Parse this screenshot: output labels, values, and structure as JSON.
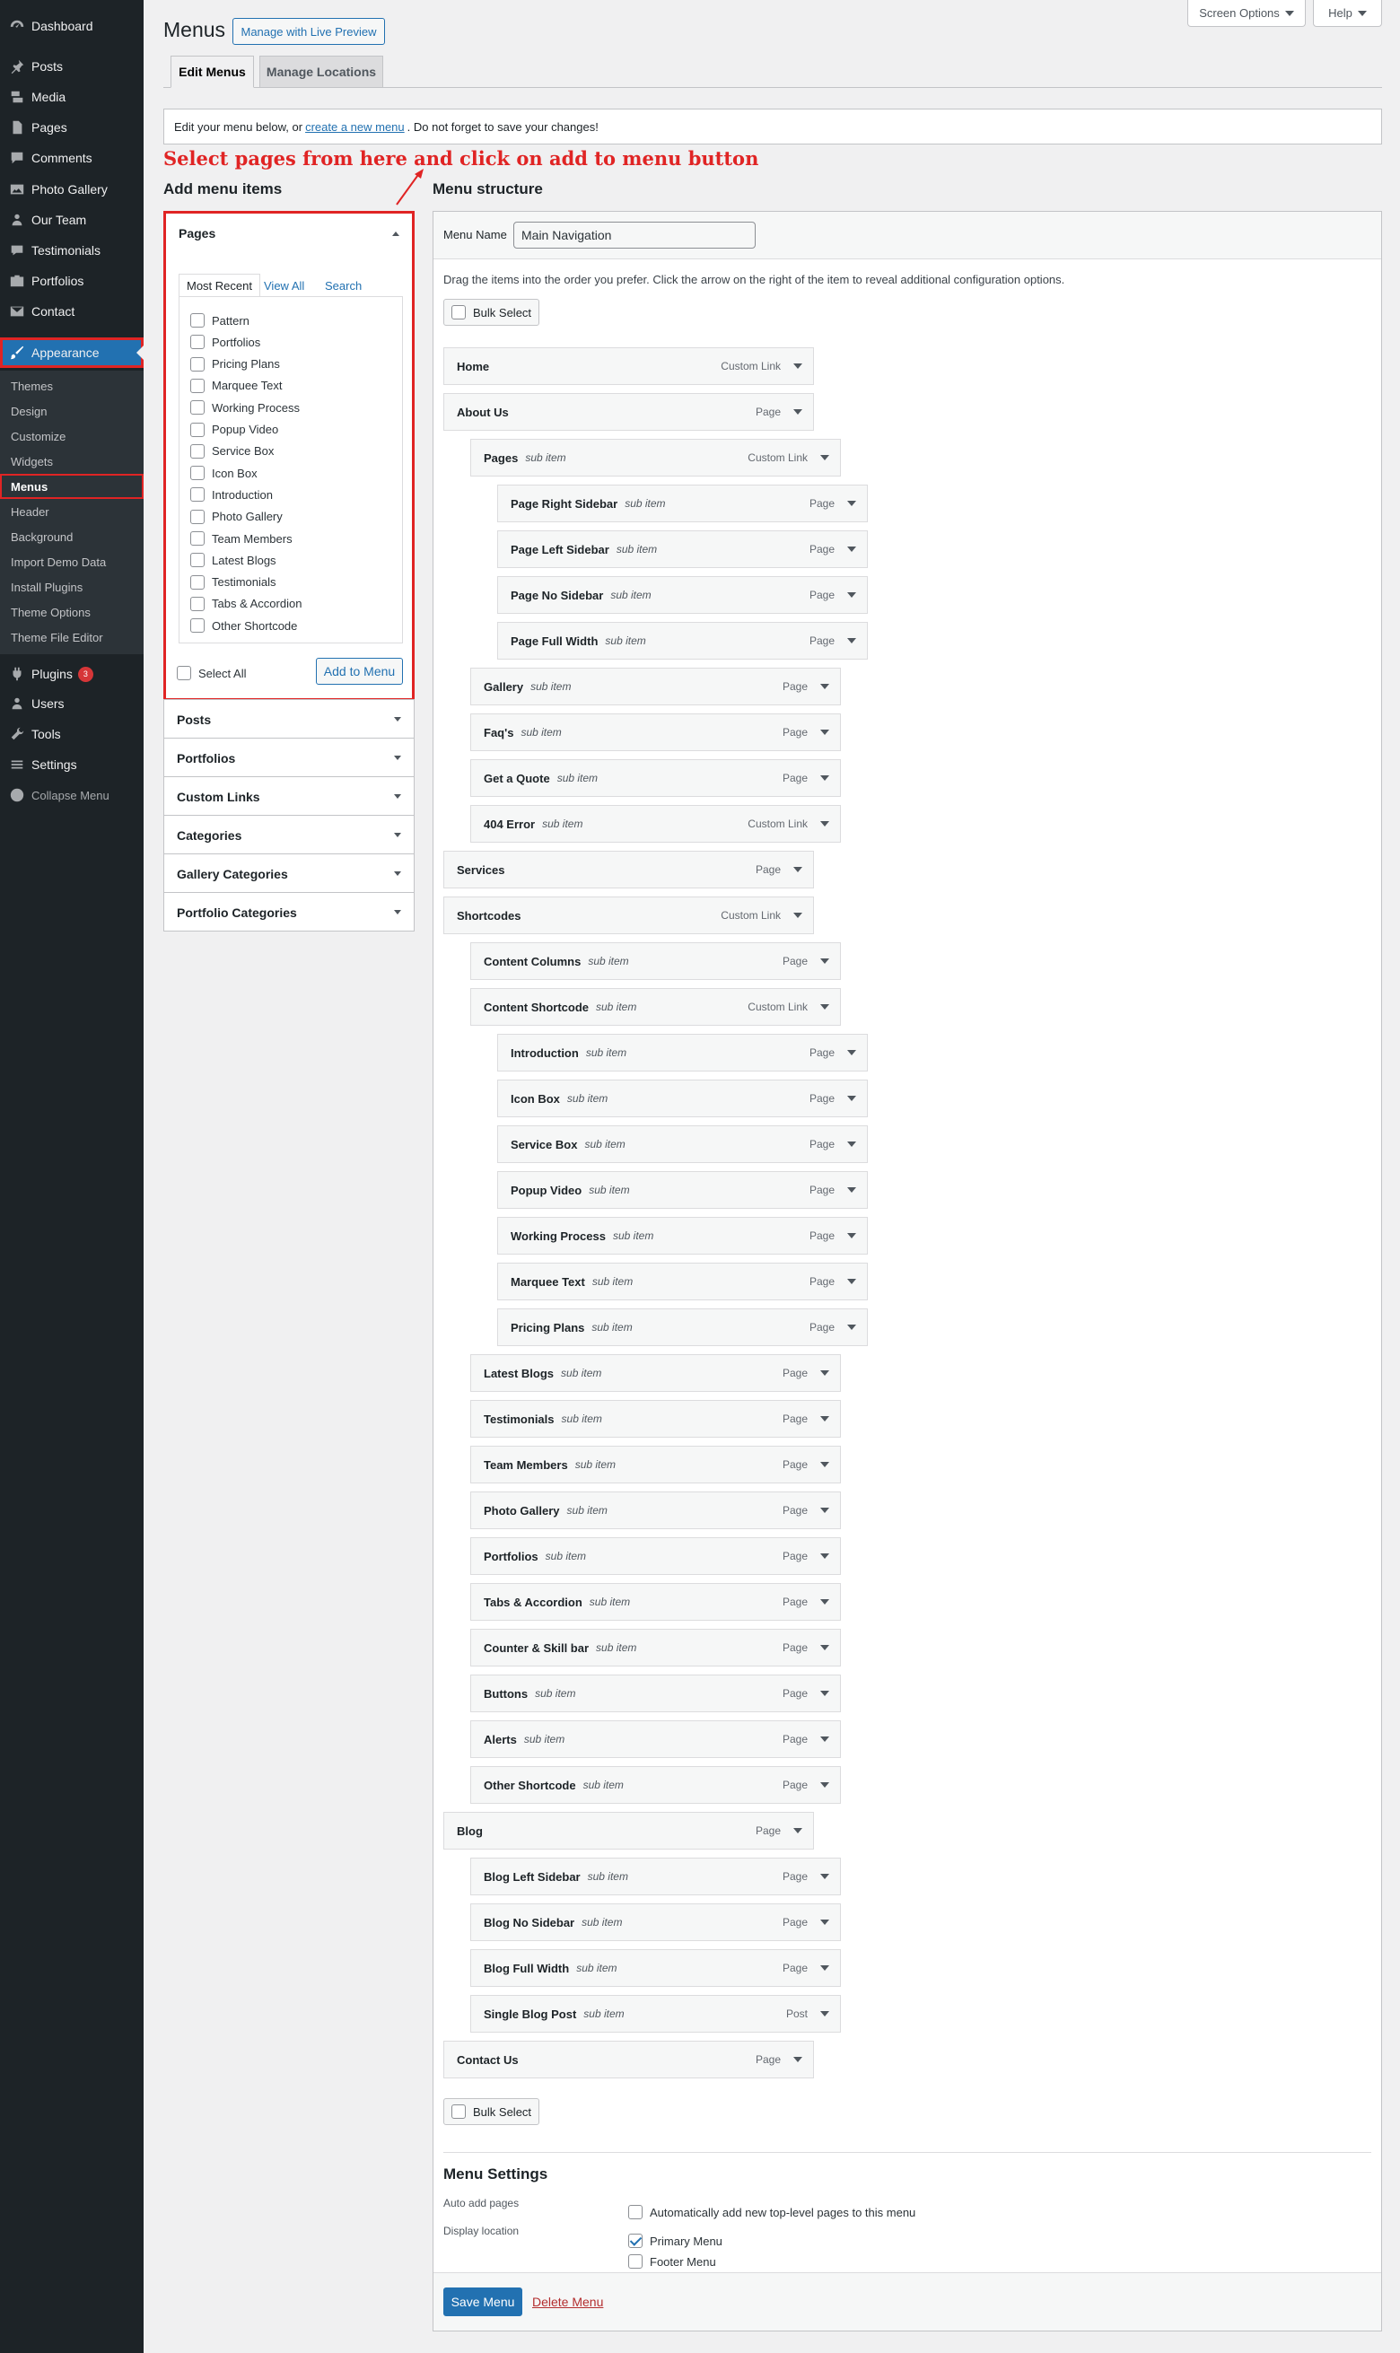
{
  "sidebar": {
    "items": [
      {
        "label": "Dashboard",
        "icon": "dashboard-icon"
      },
      {
        "label": "Posts",
        "icon": "pin-icon"
      },
      {
        "label": "Media",
        "icon": "media-icon"
      },
      {
        "label": "Pages",
        "icon": "page-icon"
      },
      {
        "label": "Comments",
        "icon": "comment-icon"
      },
      {
        "label": "Photo Gallery",
        "icon": "gallery-icon"
      },
      {
        "label": "Our Team",
        "icon": "team-icon"
      },
      {
        "label": "Testimonials",
        "icon": "testimonial-icon"
      },
      {
        "label": "Portfolios",
        "icon": "portfolio-icon"
      },
      {
        "label": "Contact",
        "icon": "mail-icon"
      },
      {
        "label": "Appearance",
        "icon": "brush-icon"
      }
    ],
    "submenu": [
      "Themes",
      "Design",
      "Customize",
      "Widgets",
      "Menus",
      "Header",
      "Background",
      "Import Demo Data",
      "Install Plugins",
      "Theme Options",
      "Theme File Editor"
    ],
    "bottom": [
      {
        "label": "Plugins",
        "icon": "plugin-icon",
        "badge": "3"
      },
      {
        "label": "Users",
        "icon": "users-icon"
      },
      {
        "label": "Tools",
        "icon": "wrench-icon"
      },
      {
        "label": "Settings",
        "icon": "settings-icon"
      },
      {
        "label": "Collapse Menu",
        "icon": "collapse-icon"
      }
    ]
  },
  "top": {
    "screen_options": "Screen Options",
    "help": "Help"
  },
  "header": {
    "title": "Menus",
    "live_preview": "Manage with Live Preview"
  },
  "tabs": {
    "edit": "Edit Menus",
    "locations": "Manage Locations"
  },
  "notice": {
    "before": "Edit your menu below, or",
    "link": "create a new menu",
    "after": ". Do not forget to save your changes!"
  },
  "annotation": "Select pages from here and click on add to menu button",
  "add_items": {
    "heading": "Add menu items",
    "pages": {
      "title": "Pages",
      "tabs": [
        "Most Recent",
        "View All",
        "Search"
      ],
      "list": [
        "Pattern",
        "Portfolios",
        "Pricing Plans",
        "Marquee Text",
        "Working Process",
        "Popup Video",
        "Service Box",
        "Icon Box",
        "Introduction",
        "Photo Gallery",
        "Team Members",
        "Latest Blogs",
        "Testimonials",
        "Tabs & Accordion",
        "Other Shortcode"
      ],
      "select_all": "Select All",
      "add_button": "Add to Menu"
    },
    "sections": [
      "Posts",
      "Portfolios",
      "Custom Links",
      "Categories",
      "Gallery Categories",
      "Portfolio Categories"
    ]
  },
  "structure": {
    "heading": "Menu structure",
    "name_label": "Menu Name",
    "name_value": "Main Navigation",
    "description": "Drag the items into the order you prefer. Click the arrow on the right of the item to reveal additional configuration options.",
    "bulk_select": "Bulk Select",
    "sub_label": "sub item",
    "items": [
      {
        "title": "Home",
        "type": "Custom Link",
        "depth": 0
      },
      {
        "title": "About Us",
        "type": "Page",
        "depth": 0
      },
      {
        "title": "Pages",
        "type": "Custom Link",
        "depth": 1
      },
      {
        "title": "Page Right Sidebar",
        "type": "Page",
        "depth": 2
      },
      {
        "title": "Page Left Sidebar",
        "type": "Page",
        "depth": 2
      },
      {
        "title": "Page No Sidebar",
        "type": "Page",
        "depth": 2
      },
      {
        "title": "Page Full Width",
        "type": "Page",
        "depth": 2
      },
      {
        "title": "Gallery",
        "type": "Page",
        "depth": 1
      },
      {
        "title": "Faq's",
        "type": "Page",
        "depth": 1
      },
      {
        "title": "Get a Quote",
        "type": "Page",
        "depth": 1
      },
      {
        "title": "404 Error",
        "type": "Custom Link",
        "depth": 1
      },
      {
        "title": "Services",
        "type": "Page",
        "depth": 0
      },
      {
        "title": "Shortcodes",
        "type": "Custom Link",
        "depth": 0
      },
      {
        "title": "Content Columns",
        "type": "Page",
        "depth": 1
      },
      {
        "title": "Content Shortcode",
        "type": "Custom Link",
        "depth": 1
      },
      {
        "title": "Introduction",
        "type": "Page",
        "depth": 2
      },
      {
        "title": "Icon Box",
        "type": "Page",
        "depth": 2
      },
      {
        "title": "Service Box",
        "type": "Page",
        "depth": 2
      },
      {
        "title": "Popup Video",
        "type": "Page",
        "depth": 2
      },
      {
        "title": "Working Process",
        "type": "Page",
        "depth": 2
      },
      {
        "title": "Marquee Text",
        "type": "Page",
        "depth": 2
      },
      {
        "title": "Pricing Plans",
        "type": "Page",
        "depth": 2
      },
      {
        "title": "Latest Blogs",
        "type": "Page",
        "depth": 1
      },
      {
        "title": "Testimonials",
        "type": "Page",
        "depth": 1
      },
      {
        "title": "Team Members",
        "type": "Page",
        "depth": 1
      },
      {
        "title": "Photo Gallery",
        "type": "Page",
        "depth": 1
      },
      {
        "title": "Portfolios",
        "type": "Page",
        "depth": 1
      },
      {
        "title": "Tabs & Accordion",
        "type": "Page",
        "depth": 1
      },
      {
        "title": "Counter & Skill bar",
        "type": "Page",
        "depth": 1
      },
      {
        "title": "Buttons",
        "type": "Page",
        "depth": 1
      },
      {
        "title": "Alerts",
        "type": "Page",
        "depth": 1
      },
      {
        "title": "Other Shortcode",
        "type": "Page",
        "depth": 1
      },
      {
        "title": "Blog",
        "type": "Page",
        "depth": 0
      },
      {
        "title": "Blog Left Sidebar",
        "type": "Page",
        "depth": 1
      },
      {
        "title": "Blog No Sidebar",
        "type": "Page",
        "depth": 1
      },
      {
        "title": "Blog Full Width",
        "type": "Page",
        "depth": 1
      },
      {
        "title": "Single Blog Post",
        "type": "Post",
        "depth": 1
      },
      {
        "title": "Contact Us",
        "type": "Page",
        "depth": 0
      }
    ],
    "settings": {
      "heading": "Menu Settings",
      "auto_add_label": "Auto add pages",
      "auto_add_text": "Automatically add new top-level pages to this menu",
      "display_label": "Display location",
      "primary": "Primary Menu",
      "footer": "Footer Menu"
    },
    "save": "Save Menu",
    "delete": "Delete Menu"
  },
  "colors": {
    "accent": "#2271b1",
    "highlight": "#e02424",
    "sidebar": "#1d2327"
  }
}
